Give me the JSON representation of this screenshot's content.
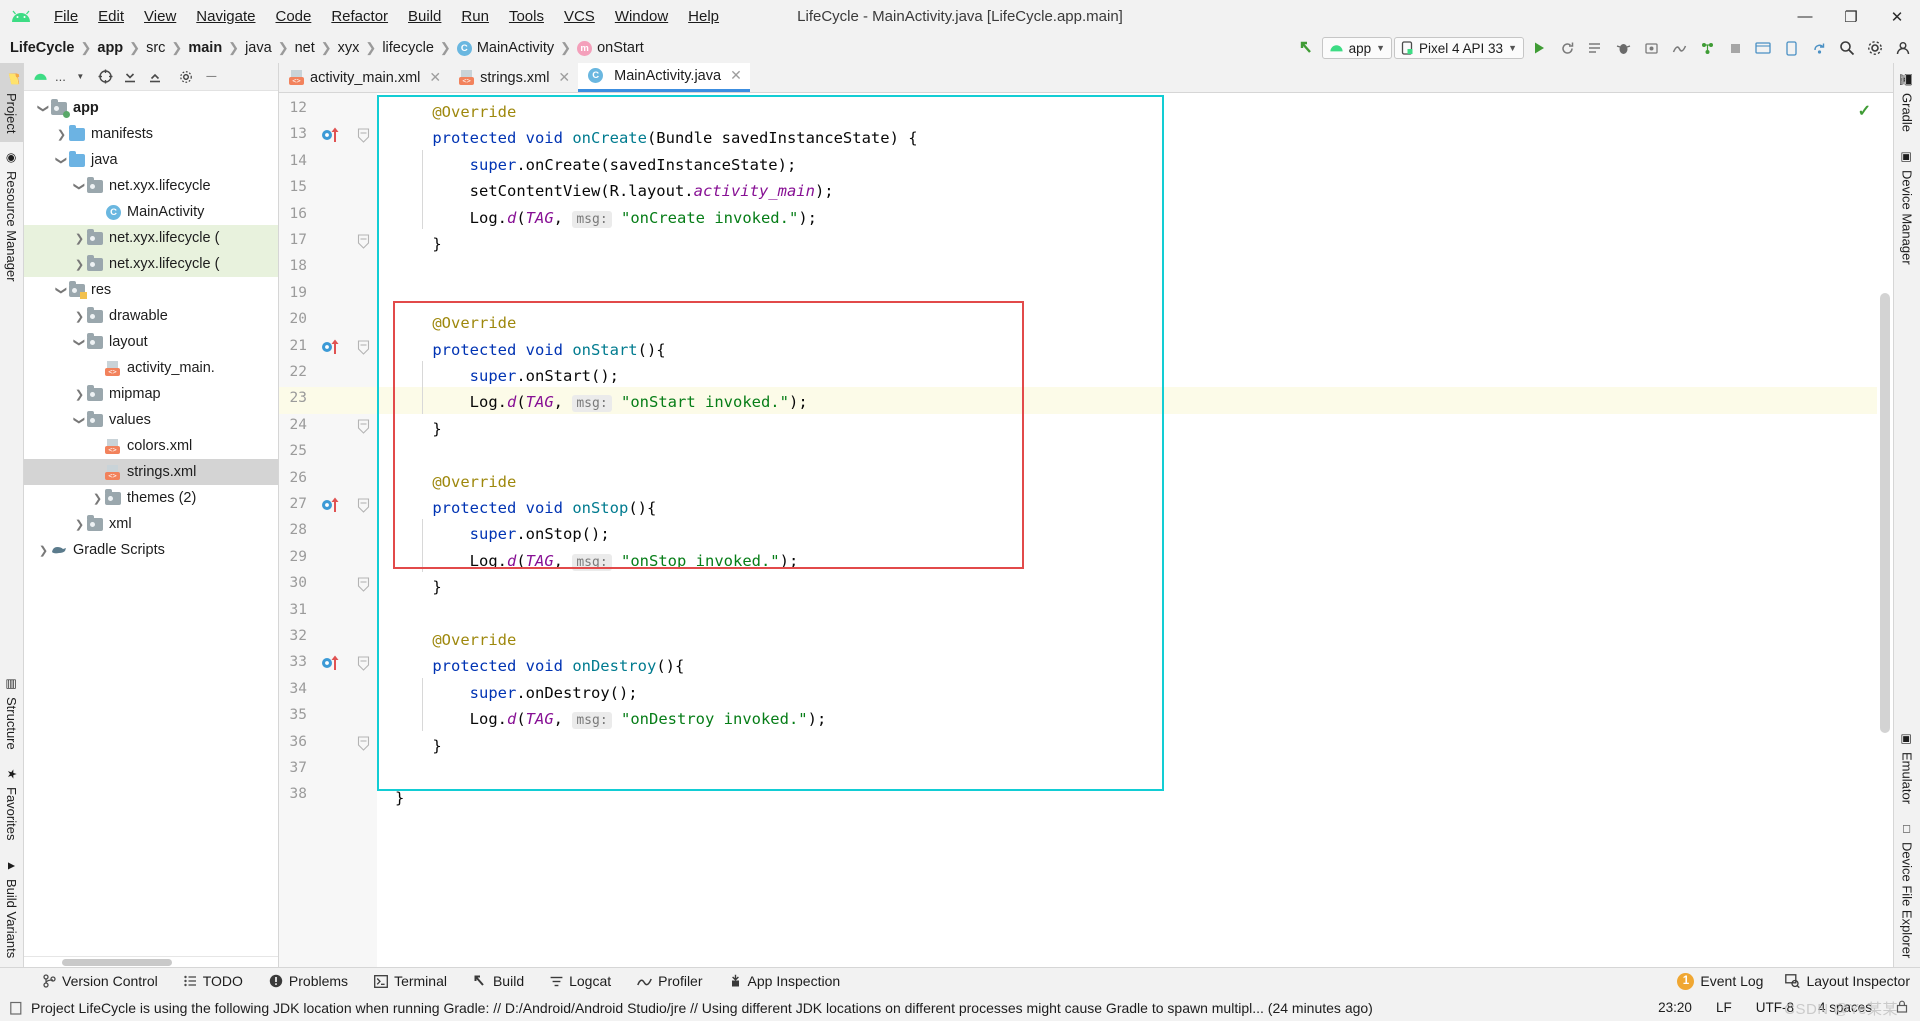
{
  "window": {
    "title": "LifeCycle - MainActivity.java [LifeCycle.app.main]",
    "minimize": "—",
    "maximize": "❐",
    "close": "✕"
  },
  "menu": [
    {
      "label": "File"
    },
    {
      "label": "Edit"
    },
    {
      "label": "View"
    },
    {
      "label": "Navigate"
    },
    {
      "label": "Code"
    },
    {
      "label": "Refactor"
    },
    {
      "label": "Build"
    },
    {
      "label": "Run"
    },
    {
      "label": "Tools"
    },
    {
      "label": "VCS"
    },
    {
      "label": "Window"
    },
    {
      "label": "Help"
    }
  ],
  "breadcrumb": [
    {
      "label": "LifeCycle",
      "bold": true
    },
    {
      "label": "app",
      "bold": true
    },
    {
      "label": "src",
      "bold": false
    },
    {
      "label": "main",
      "bold": true
    },
    {
      "label": "java",
      "bold": false
    },
    {
      "label": "net",
      "bold": false
    },
    {
      "label": "xyx",
      "bold": false
    },
    {
      "label": "lifecycle",
      "bold": false
    },
    {
      "label": "MainActivity",
      "bold": false,
      "icon": "class-icon",
      "icon_letter": "C"
    },
    {
      "label": "onStart",
      "bold": false,
      "icon": "method-icon",
      "icon_letter": "m"
    }
  ],
  "toolbar": {
    "module_selector": "app",
    "device_selector": "Pixel 4 API 33",
    "run_button": "run-icon",
    "rerun_button": "rerun-icon",
    "apply_changes": "apply-changes-icon",
    "debug_button": "debug-icon",
    "search_icon": "search-icon",
    "settings_icon": "gear-icon"
  },
  "left_tool_tabs": [
    {
      "label": "Project",
      "icon": "project-icon",
      "selected": true
    },
    {
      "label": "Resource Manager",
      "icon": "resource-manager-icon",
      "selected": false
    },
    {
      "label": "Structure",
      "icon": "structure-icon",
      "selected": false
    },
    {
      "label": "Favorites",
      "icon": "favorites-star-icon",
      "selected": false
    },
    {
      "label": "Build Variants",
      "icon": "build-variants-icon",
      "selected": false
    }
  ],
  "right_tool_tabs": [
    {
      "label": "Gradle",
      "icon": "gradle-elephant-icon"
    },
    {
      "label": "Device Manager",
      "icon": "device-manager-icon"
    },
    {
      "label": "Emulator",
      "icon": "emulator-icon"
    },
    {
      "label": "Device File Explorer",
      "icon": "device-file-explorer-icon"
    }
  ],
  "project_panel": {
    "title": "...",
    "tree": [
      {
        "label": "app",
        "indent": 0,
        "arrow": "down",
        "icon": "module-folder",
        "bold": true,
        "state": "normal"
      },
      {
        "label": "manifests",
        "indent": 1,
        "arrow": "right",
        "icon": "blue-folder",
        "bold": false,
        "state": "normal"
      },
      {
        "label": "java",
        "indent": 1,
        "arrow": "down",
        "icon": "blue-folder",
        "bold": false,
        "state": "normal"
      },
      {
        "label": "net.xyx.lifecycle",
        "indent": 2,
        "arrow": "down",
        "icon": "package",
        "bold": false,
        "state": "normal"
      },
      {
        "label": "MainActivity",
        "indent": 3,
        "arrow": "none",
        "icon": "class-icon",
        "bold": false,
        "state": "normal"
      },
      {
        "label": "net.xyx.lifecycle (",
        "indent": 2,
        "arrow": "right",
        "icon": "package",
        "bold": false,
        "state": "green"
      },
      {
        "label": "net.xyx.lifecycle (",
        "indent": 2,
        "arrow": "right",
        "icon": "package",
        "bold": false,
        "state": "green"
      },
      {
        "label": "res",
        "indent": 1,
        "arrow": "down",
        "icon": "res-folder",
        "bold": false,
        "state": "normal"
      },
      {
        "label": "drawable",
        "indent": 2,
        "arrow": "right",
        "icon": "package",
        "bold": false,
        "state": "normal"
      },
      {
        "label": "layout",
        "indent": 2,
        "arrow": "down",
        "icon": "package",
        "bold": false,
        "state": "normal"
      },
      {
        "label": "activity_main.",
        "indent": 3,
        "arrow": "none",
        "icon": "xml-file",
        "bold": false,
        "state": "normal"
      },
      {
        "label": "mipmap",
        "indent": 2,
        "arrow": "right",
        "icon": "package",
        "bold": false,
        "state": "normal"
      },
      {
        "label": "values",
        "indent": 2,
        "arrow": "down",
        "icon": "package",
        "bold": false,
        "state": "normal"
      },
      {
        "label": "colors.xml",
        "indent": 3,
        "arrow": "none",
        "icon": "xml-file",
        "bold": false,
        "state": "normal"
      },
      {
        "label": "strings.xml",
        "indent": 3,
        "arrow": "none",
        "icon": "xml-file",
        "bold": false,
        "state": "selected"
      },
      {
        "label": "themes (2)",
        "indent": 3,
        "arrow": "right",
        "icon": "package",
        "bold": false,
        "state": "normal"
      },
      {
        "label": "xml",
        "indent": 2,
        "arrow": "right",
        "icon": "package",
        "bold": false,
        "state": "normal"
      },
      {
        "label": "Gradle Scripts",
        "indent": 0,
        "arrow": "right",
        "icon": "gradle-elephant-icon",
        "bold": false,
        "state": "normal"
      }
    ]
  },
  "editor": {
    "tabs": [
      {
        "label": "activity_main.xml",
        "icon": "xml-file",
        "active": false
      },
      {
        "label": "strings.xml",
        "icon": "xml-file",
        "active": false
      },
      {
        "label": "MainActivity.java",
        "icon": "class-icon",
        "active": true
      }
    ],
    "first_line_number": 12,
    "line_numbers": [
      12,
      13,
      14,
      15,
      16,
      17,
      18,
      19,
      20,
      21,
      22,
      23,
      24,
      25,
      26,
      27,
      28,
      29,
      30,
      31,
      32,
      33,
      34,
      35,
      36,
      37,
      38
    ],
    "highlighted_line": 23,
    "inspection_status": "check-icon",
    "code_lines": [
      {
        "n": 12,
        "segments": [
          {
            "t": "    ",
            "c": "pl"
          },
          {
            "t": "@Override",
            "c": "ann"
          }
        ]
      },
      {
        "n": 13,
        "segments": [
          {
            "t": "    ",
            "c": "pl"
          },
          {
            "t": "protected void ",
            "c": "k"
          },
          {
            "t": "onCreate",
            "c": "mth"
          },
          {
            "t": "(Bundle savedInstanceState) {",
            "c": "pl"
          }
        ]
      },
      {
        "n": 14,
        "segments": [
          {
            "t": "        ",
            "c": "pl"
          },
          {
            "t": "super",
            "c": "k"
          },
          {
            "t": ".onCreate(savedInstanceState);",
            "c": "pl"
          }
        ]
      },
      {
        "n": 15,
        "segments": [
          {
            "t": "        setContentView(R.layout.",
            "c": "pl"
          },
          {
            "t": "activity_main",
            "c": "fld"
          },
          {
            "t": ");",
            "c": "pl"
          }
        ]
      },
      {
        "n": 16,
        "segments": [
          {
            "t": "        Log.",
            "c": "pl"
          },
          {
            "t": "d",
            "c": "fld"
          },
          {
            "t": "(",
            "c": "pl"
          },
          {
            "t": "TAG",
            "c": "fld"
          },
          {
            "t": ", ",
            "c": "pl"
          },
          {
            "t": "msg:",
            "c": "hint"
          },
          {
            "t": " ",
            "c": "pl"
          },
          {
            "t": "\"onCreate invoked.\"",
            "c": "str"
          },
          {
            "t": ");",
            "c": "pl"
          }
        ]
      },
      {
        "n": 17,
        "segments": [
          {
            "t": "    }",
            "c": "pl"
          }
        ]
      },
      {
        "n": 18,
        "segments": []
      },
      {
        "n": 19,
        "segments": []
      },
      {
        "n": 20,
        "segments": [
          {
            "t": "    ",
            "c": "pl"
          },
          {
            "t": "@Override",
            "c": "ann"
          }
        ]
      },
      {
        "n": 21,
        "segments": [
          {
            "t": "    ",
            "c": "pl"
          },
          {
            "t": "protected void ",
            "c": "k"
          },
          {
            "t": "onStart",
            "c": "mth"
          },
          {
            "t": "(){",
            "c": "pl"
          }
        ]
      },
      {
        "n": 22,
        "segments": [
          {
            "t": "        ",
            "c": "pl"
          },
          {
            "t": "super",
            "c": "k"
          },
          {
            "t": ".onStart();",
            "c": "pl"
          }
        ]
      },
      {
        "n": 23,
        "segments": [
          {
            "t": "        Log.",
            "c": "pl"
          },
          {
            "t": "d",
            "c": "fld"
          },
          {
            "t": "(",
            "c": "pl"
          },
          {
            "t": "TAG",
            "c": "fld"
          },
          {
            "t": ", ",
            "c": "pl"
          },
          {
            "t": "msg:",
            "c": "hint"
          },
          {
            "t": " ",
            "c": "pl"
          },
          {
            "t": "\"onStart invoked.\"",
            "c": "str"
          },
          {
            "t": ");",
            "c": "pl"
          }
        ]
      },
      {
        "n": 24,
        "segments": [
          {
            "t": "    }",
            "c": "pl"
          }
        ]
      },
      {
        "n": 25,
        "segments": []
      },
      {
        "n": 26,
        "segments": [
          {
            "t": "    ",
            "c": "pl"
          },
          {
            "t": "@Override",
            "c": "ann"
          }
        ]
      },
      {
        "n": 27,
        "segments": [
          {
            "t": "    ",
            "c": "pl"
          },
          {
            "t": "protected void ",
            "c": "k"
          },
          {
            "t": "onStop",
            "c": "mth"
          },
          {
            "t": "(){",
            "c": "pl"
          }
        ]
      },
      {
        "n": 28,
        "segments": [
          {
            "t": "        ",
            "c": "pl"
          },
          {
            "t": "super",
            "c": "k"
          },
          {
            "t": ".onStop();",
            "c": "pl"
          }
        ]
      },
      {
        "n": 29,
        "segments": [
          {
            "t": "        Log.",
            "c": "pl"
          },
          {
            "t": "d",
            "c": "fld"
          },
          {
            "t": "(",
            "c": "pl"
          },
          {
            "t": "TAG",
            "c": "fld"
          },
          {
            "t": ", ",
            "c": "pl"
          },
          {
            "t": "msg:",
            "c": "hint"
          },
          {
            "t": " ",
            "c": "pl"
          },
          {
            "t": "\"onStop invoked.\"",
            "c": "str"
          },
          {
            "t": ");",
            "c": "pl"
          }
        ]
      },
      {
        "n": 30,
        "segments": [
          {
            "t": "    }",
            "c": "pl"
          }
        ]
      },
      {
        "n": 31,
        "segments": []
      },
      {
        "n": 32,
        "segments": [
          {
            "t": "    ",
            "c": "pl"
          },
          {
            "t": "@Override",
            "c": "ann"
          }
        ]
      },
      {
        "n": 33,
        "segments": [
          {
            "t": "    ",
            "c": "pl"
          },
          {
            "t": "protected void ",
            "c": "k"
          },
          {
            "t": "onDestroy",
            "c": "mth"
          },
          {
            "t": "(){",
            "c": "pl"
          }
        ]
      },
      {
        "n": 34,
        "segments": [
          {
            "t": "        ",
            "c": "pl"
          },
          {
            "t": "super",
            "c": "k"
          },
          {
            "t": ".onDestroy();",
            "c": "pl"
          }
        ]
      },
      {
        "n": 35,
        "segments": [
          {
            "t": "        Log.",
            "c": "pl"
          },
          {
            "t": "d",
            "c": "fld"
          },
          {
            "t": "(",
            "c": "pl"
          },
          {
            "t": "TAG",
            "c": "fld"
          },
          {
            "t": ", ",
            "c": "pl"
          },
          {
            "t": "msg:",
            "c": "hint"
          },
          {
            "t": " ",
            "c": "pl"
          },
          {
            "t": "\"onDestroy invoked.\"",
            "c": "str"
          },
          {
            "t": ");",
            "c": "pl"
          }
        ]
      },
      {
        "n": 36,
        "segments": [
          {
            "t": "    }",
            "c": "pl"
          }
        ]
      },
      {
        "n": 37,
        "segments": []
      },
      {
        "n": 38,
        "segments": [
          {
            "t": "}",
            "c": "pl"
          }
        ]
      }
    ],
    "gutter_markers": [
      {
        "line": 13,
        "type": "override-marker"
      },
      {
        "line": 21,
        "type": "override-marker"
      },
      {
        "line": 27,
        "type": "override-marker"
      },
      {
        "line": 33,
        "type": "override-marker"
      },
      {
        "line": 23,
        "type": "intention-bulb"
      }
    ],
    "annotations": {
      "teal_box_label": "class-body-highlight",
      "red_box_label": "onStart-onStop-highlight"
    }
  },
  "status_buttons": [
    {
      "label": "Version Control",
      "icon": "branch-icon"
    },
    {
      "label": "TODO",
      "icon": "todo-list-icon"
    },
    {
      "label": "Problems",
      "icon": "problems-icon"
    },
    {
      "label": "Terminal",
      "icon": "terminal-icon"
    },
    {
      "label": "Build",
      "icon": "build-hammer-icon"
    },
    {
      "label": "Logcat",
      "icon": "logcat-icon"
    },
    {
      "label": "Profiler",
      "icon": "profiler-icon"
    },
    {
      "label": "App Inspection",
      "icon": "app-inspection-icon"
    }
  ],
  "status_right": {
    "event_log_count": "1",
    "event_log": "Event Log",
    "layout_inspector": "Layout Inspector"
  },
  "message_bar": {
    "icon": "info-icon",
    "text": "Project LifeCycle is using the following JDK location when running Gradle: // D:/Android/Android Studio/jre // Using different JDK locations on different processes might cause Gradle to spawn multipl... (24 minutes ago)",
    "caret_position": "23:20",
    "line_separator": "LF",
    "encoding": "UTF-8",
    "indent": "4 spaces",
    "watermark": "CSDN @Ye某某"
  },
  "colors": {
    "accent_blue": "#3c8ee0",
    "teal_box": "#12cdd4",
    "red_box": "#e24a4a",
    "green_row": "#e8f2dd",
    "highlight_line": "#fcfbe8",
    "keyword": "#0033b3",
    "method": "#007b8f",
    "annotation": "#9e880d",
    "string": "#067d17",
    "static_field": "#871094"
  }
}
